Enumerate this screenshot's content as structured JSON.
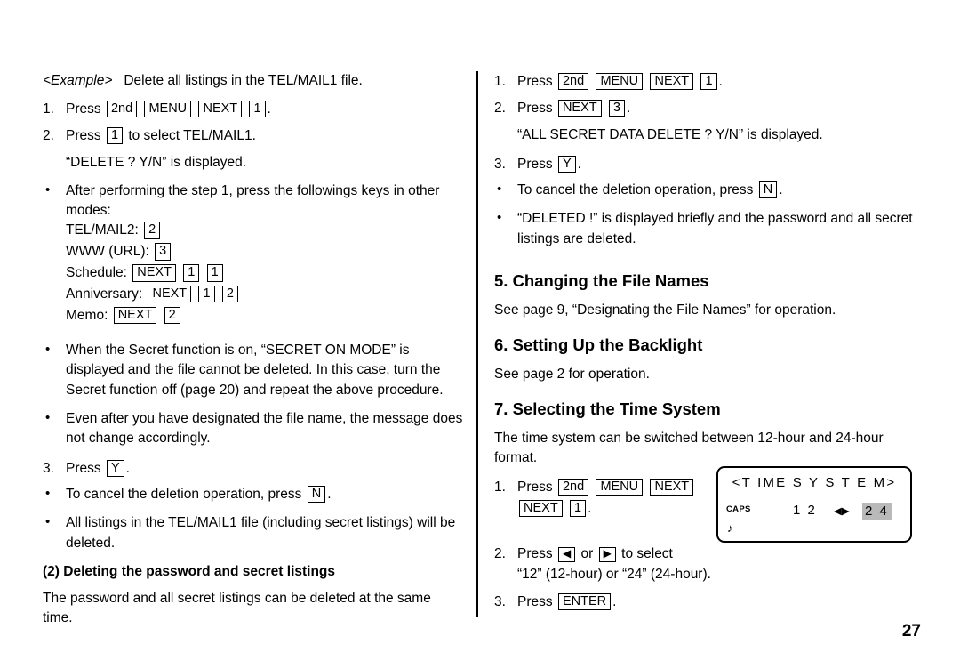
{
  "page": {
    "number": "27"
  },
  "left_column": {
    "example_tag": "<Example>",
    "example_text": "Delete all listings in the TEL/MAIL1 file.",
    "step1": {
      "num": "1.",
      "press": "Press",
      "keys": [
        "2nd",
        "MENU",
        "NEXT",
        "1"
      ],
      "period": "."
    },
    "step2": {
      "num": "2.",
      "press": "Press",
      "key": "1",
      "tail": "to select TEL/MAIL1."
    },
    "step2_display": "“DELETE ? Y/N” is displayed.",
    "bullet_modes": {
      "text": "After performing the step 1, press the followings keys in other modes:",
      "items": [
        {
          "label": "TEL/MAIL2:",
          "keys": [
            "2"
          ]
        },
        {
          "label": "WWW (URL):",
          "keys": [
            "3"
          ]
        },
        {
          "label": "Schedule:",
          "keys": [
            "NEXT",
            "1",
            "1"
          ]
        },
        {
          "label": "Anniversary:",
          "keys": [
            "NEXT",
            "1",
            "2"
          ]
        },
        {
          "label": "Memo:",
          "keys": [
            "NEXT",
            "2"
          ]
        }
      ]
    },
    "bullet_secret": "When the Secret function is on, “SECRET ON MODE” is displayed and the file cannot be deleted. In this case, turn the Secret function off (page 20) and repeat the above procedure.",
    "bullet_filename": "Even after you have designated the file name, the message does not change accordingly.",
    "step3": {
      "num": "3.",
      "press": "Press",
      "key": "Y",
      "period": "."
    },
    "bullet_cancel_pre": "To cancel the deletion operation, press",
    "bullet_cancel_key": "N",
    "bullet_cancel_post": ".",
    "bullet_alldeleted": "All listings in the TEL/MAIL1 file (including secret listings) will be deleted.",
    "subheading_2": "(2) Deleting the password and secret listings",
    "para_password": "The password and all secret listings can be deleted at the same time."
  },
  "right_column": {
    "step1": {
      "num": "1.",
      "press": "Press",
      "keys": [
        "2nd",
        "MENU",
        "NEXT",
        "1"
      ],
      "period": "."
    },
    "step2": {
      "num": "2.",
      "press": "Press",
      "keys": [
        "NEXT",
        "3"
      ],
      "period": "."
    },
    "step2_display": "“ALL SECRET DATA DELETE ? Y/N” is displayed.",
    "step3": {
      "num": "3.",
      "press": "Press",
      "key": "Y",
      "period": "."
    },
    "bullet_cancel_pre": "To cancel the deletion operation, press",
    "bullet_cancel_key": "N",
    "bullet_cancel_post": ".",
    "bullet_deleted": "“DELETED !” is displayed briefly and the password and all secret listings are deleted.",
    "heading5": "5. Changing the File Names",
    "para5": "See page 9, “Designating the File Names” for operation.",
    "heading6": "6. Setting Up the Backlight",
    "para6": "See page 2 for operation.",
    "heading7": "7. Selecting the Time System",
    "para7": "The time system can be switched between 12-hour and 24-hour format.",
    "time_step1": {
      "num": "1.",
      "press": "Press",
      "keys_line1": [
        "2nd",
        "MENU",
        "NEXT"
      ],
      "keys_line2": [
        "NEXT",
        "1"
      ],
      "period": "."
    },
    "time_step2": {
      "num": "2.",
      "press": "Press",
      "key_left": "◀",
      "or": "or",
      "key_right": "▶",
      "tail": "to select",
      "line2": "“12” (12-hour) or “24” (24-hour)."
    },
    "time_step3": {
      "num": "3.",
      "press": "Press",
      "key": "ENTER",
      "period": "."
    }
  },
  "lcd_display": {
    "title": "<T IME  S Y S T E M>",
    "caps": "CAPS",
    "note": "♪",
    "option_12": "1 2",
    "arrows": "◀▶",
    "option_24": "2 4",
    "highlight_color": "#b9b9b9"
  }
}
